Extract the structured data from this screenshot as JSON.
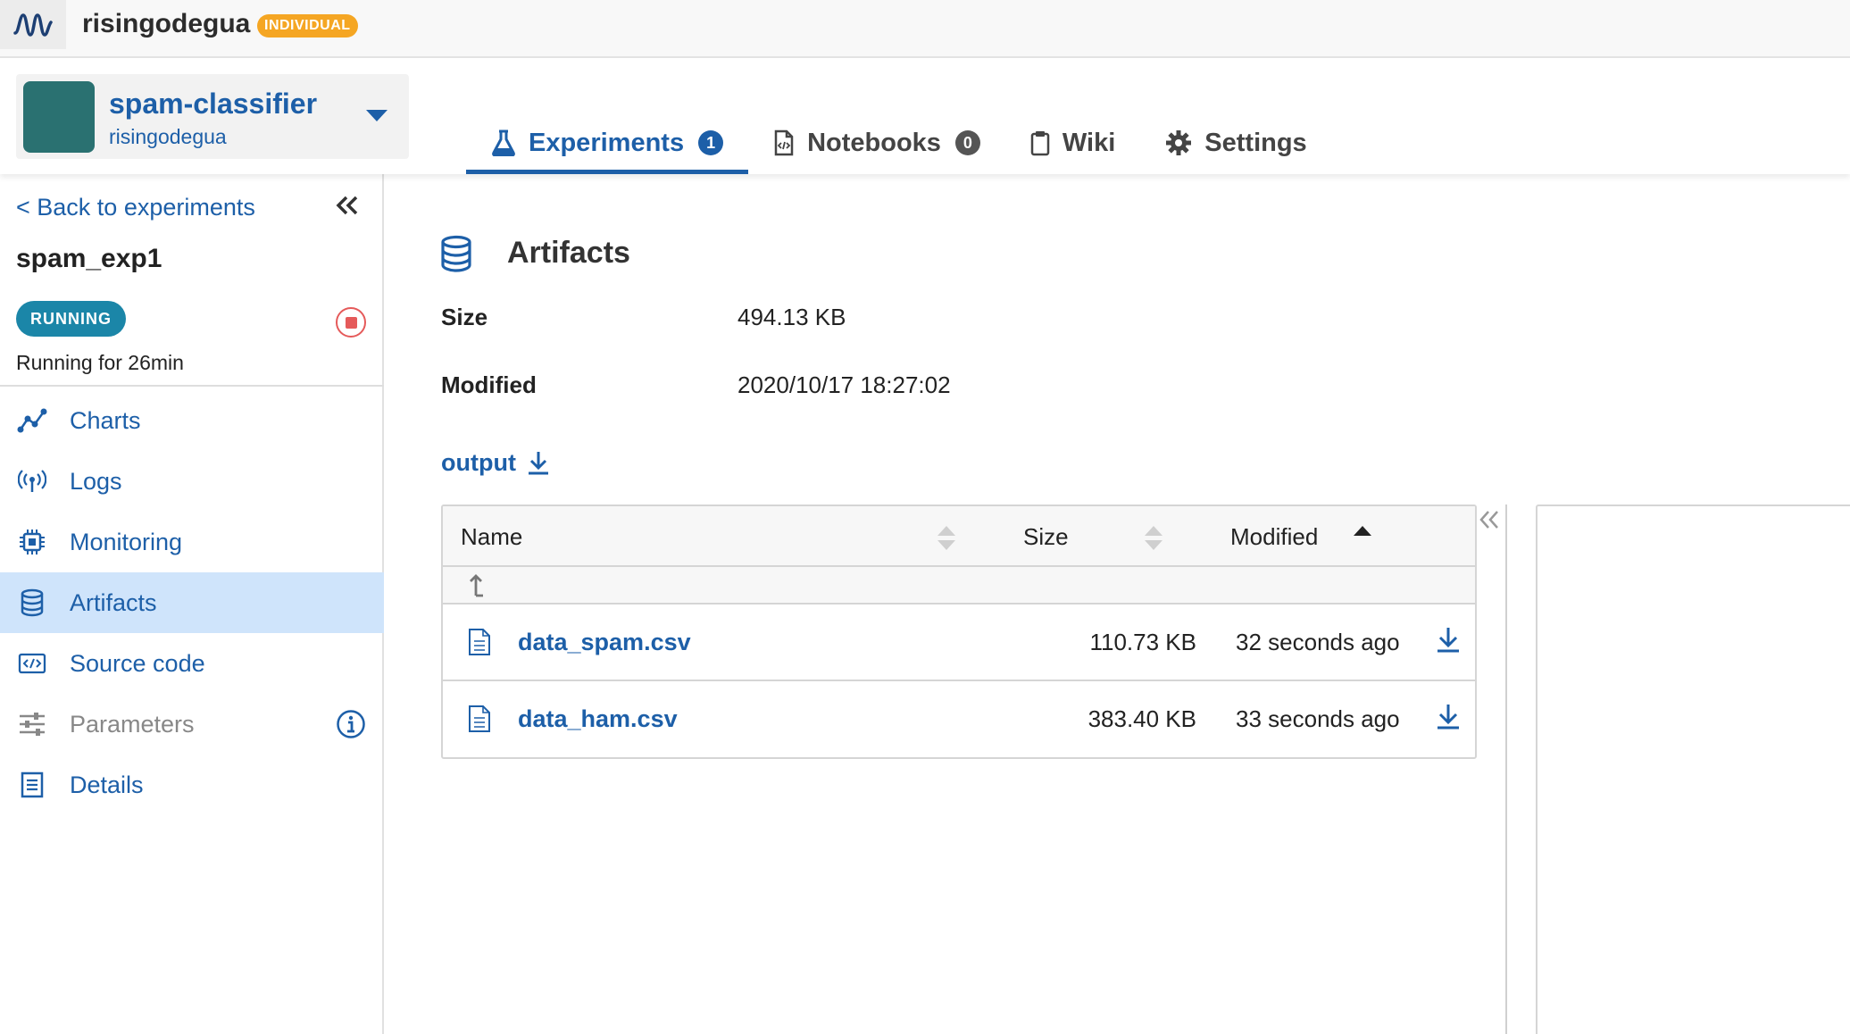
{
  "org": {
    "name": "risingodegua",
    "badge": "INDIVIDUAL",
    "logo_icon": "wave-logo-icon"
  },
  "project": {
    "name": "spam-classifier",
    "owner": "risingodegua",
    "avatar_color": "#2a7171"
  },
  "tabs": [
    {
      "label": "Experiments",
      "icon": "flask-icon",
      "count": "1",
      "active": true
    },
    {
      "label": "Notebooks",
      "icon": "notebook-icon",
      "count": "0",
      "active": false
    },
    {
      "label": "Wiki",
      "icon": "clipboard-icon",
      "active": false
    },
    {
      "label": "Settings",
      "icon": "gear-icon",
      "active": false
    }
  ],
  "sidebar": {
    "back_label": "< Back to experiments",
    "experiment_name": "spam_exp1",
    "status": "RUNNING",
    "running_for": "Running for 26min",
    "items": [
      {
        "label": "Charts",
        "icon": "chart-line-icon"
      },
      {
        "label": "Logs",
        "icon": "antenna-icon"
      },
      {
        "label": "Monitoring",
        "icon": "chip-icon"
      },
      {
        "label": "Artifacts",
        "icon": "database-icon",
        "active": true
      },
      {
        "label": "Source code",
        "icon": "code-icon"
      },
      {
        "label": "Parameters",
        "icon": "sliders-icon",
        "disabled": true
      },
      {
        "label": "Details",
        "icon": "document-icon"
      }
    ]
  },
  "main": {
    "title": "Artifacts",
    "size_label": "Size",
    "size_value": "494.13 KB",
    "modified_label": "Modified",
    "modified_value": "2020/10/17 18:27:02",
    "folder": "output",
    "table": {
      "columns": [
        "Name",
        "Size",
        "Modified"
      ],
      "sorted_by": "Modified",
      "rows": [
        {
          "name": "data_spam.csv",
          "size": "110.73 KB",
          "modified": "32 seconds ago"
        },
        {
          "name": "data_ham.csv",
          "size": "383.40 KB",
          "modified": "33 seconds ago"
        }
      ]
    }
  },
  "colors": {
    "accent": "#1d5fa8",
    "running": "#1b86a8",
    "badge": "#f5a623",
    "active_nav": "#cfe4fb",
    "stop": "#e55a5a"
  }
}
